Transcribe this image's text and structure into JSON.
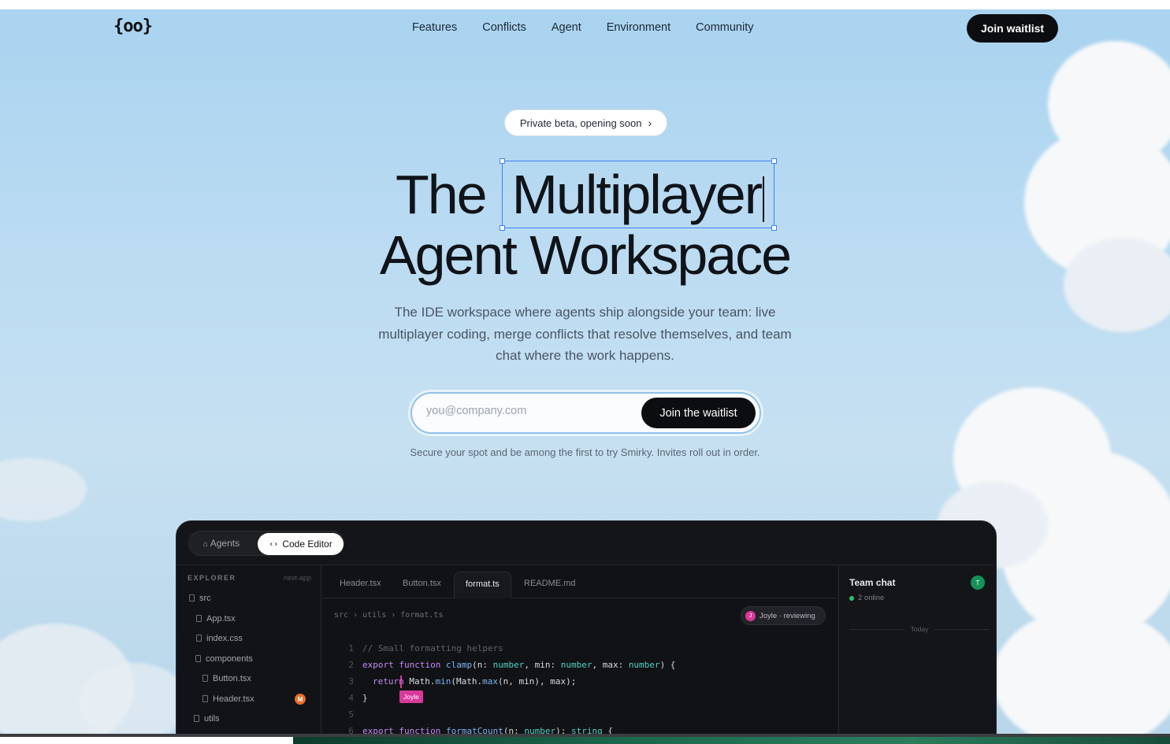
{
  "nav": {
    "logo": "{oo}",
    "links": [
      "Features",
      "Conflicts",
      "Agent",
      "Environment",
      "Community"
    ],
    "cta": "Join waitlist"
  },
  "hero": {
    "pill": "Private beta, opening soon",
    "title_word1": "The",
    "title_word2": "Multiplayer",
    "title_line2": "Agent Workspace",
    "subtitle": "The IDE workspace where agents ship alongside your team: live multiplayer coding, merge conflicts that resolve themselves, and team chat where the work happens.",
    "email_placeholder": "you@company.com",
    "email_button": "Join the waitlist",
    "note": "Secure your spot and be among the first to try Smirky. Invites roll out in order."
  },
  "ide": {
    "segment": {
      "agents": "Agents",
      "code_editor": "Code Editor"
    },
    "explorer": {
      "header": "EXPLORER",
      "workspace": "next-app",
      "files": [
        {
          "name": "src",
          "depth": 0
        },
        {
          "name": "App.tsx",
          "depth": 1
        },
        {
          "name": "index.css",
          "depth": 1
        },
        {
          "name": "components",
          "depth": 1
        },
        {
          "name": "Button.tsx",
          "depth": 2
        },
        {
          "name": "Header.tsx",
          "depth": 2,
          "badge": "M"
        },
        {
          "name": "utils",
          "depth": 0
        }
      ]
    },
    "tabs": [
      "Header.tsx",
      "Button.tsx",
      "format.ts",
      "README.md"
    ],
    "active_tab": "format.ts",
    "breadcrumb": "src › utils › format.ts",
    "reviewer": {
      "initial": "J",
      "label": "Joyle · reviewing"
    },
    "code_lines": [
      {
        "n": "1",
        "text": "// Small formatting helpers"
      },
      {
        "n": "2",
        "text": "export function clamp(n: number, min: number, max: number) {"
      },
      {
        "n": "3",
        "text": "  return Math.min(Math.max(n, min), max);"
      },
      {
        "n": "4",
        "text": "}"
      },
      {
        "n": "5",
        "text": ""
      },
      {
        "n": "6",
        "text": "export function formatCount(n: number): string {"
      }
    ],
    "cursor_user": "Joyle",
    "chat": {
      "title": "Team chat",
      "online": "2 online",
      "avatar": "T",
      "divider": "Today"
    }
  },
  "colors": {
    "accent_blue": "#3b82f6",
    "dark_button": "#0c0d10",
    "joyle_pink": "#d9399a",
    "online_green": "#2fbf71"
  }
}
